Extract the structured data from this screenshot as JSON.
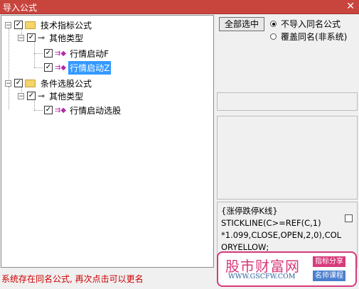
{
  "window": {
    "title": "导入公式",
    "close_glyph": "✕"
  },
  "tree": {
    "nodes": [
      {
        "label": "技术指标公式",
        "expander": "−",
        "checked": "✓"
      },
      {
        "label": "其他类型",
        "expander": "−",
        "checked": "✓"
      },
      {
        "label": "行情启动F",
        "checked": "✓"
      },
      {
        "label": "行情启动Z",
        "checked": "✓",
        "selected": true
      },
      {
        "label": "条件选股公式",
        "expander": "−",
        "checked": "✓"
      },
      {
        "label": "其他类型",
        "expander": "−",
        "checked": "✓"
      },
      {
        "label": "行情启动选股",
        "checked": "✓"
      }
    ]
  },
  "buttons": {
    "select_all": "全部选中"
  },
  "options": {
    "no_import_same_name": "不导入同名公式",
    "overwrite_same_name": "覆盖同名(非系统)",
    "selected": "no_import_same_name"
  },
  "code": {
    "lines": [
      "{涨停跌停K线}",
      "STICKLINE(C>=REF(C,1)",
      "*1.099,CLOSE,OPEN,2,0),COL",
      "ORYELLOW;"
    ]
  },
  "status": {
    "message": "系统存在同名公式, 再次点击可以更名"
  },
  "watermark": {
    "name": "股市财富网",
    "url": "WWW.GSCFW.COM",
    "tag1": "指标分享",
    "tag2": "名师课程"
  },
  "colors": {
    "titlebar": "#c8453e",
    "selection": "#3399ff",
    "status_text": "#cc0000",
    "watermark_accent": "#d63a7a"
  }
}
